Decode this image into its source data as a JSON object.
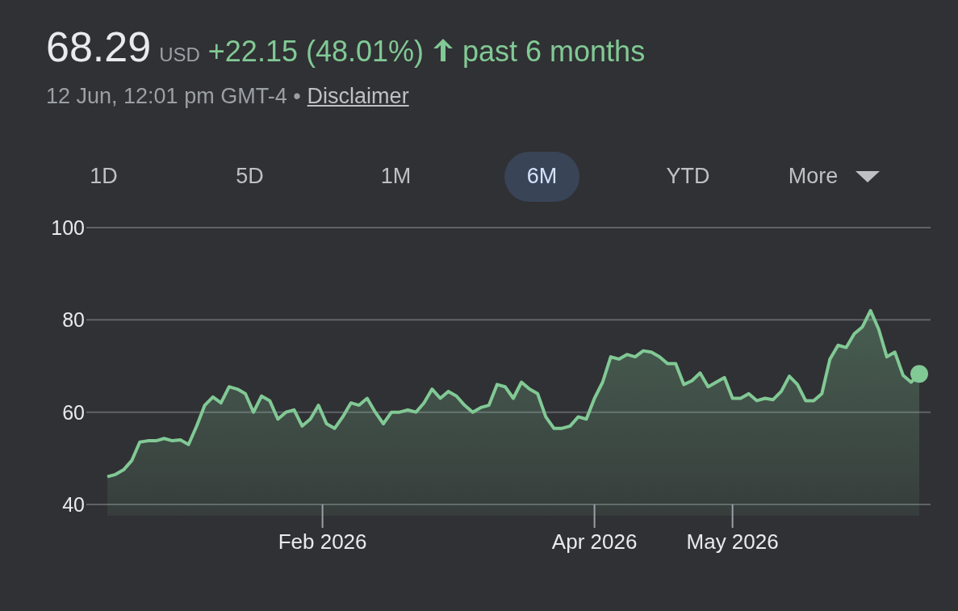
{
  "quote": {
    "price": "68.29",
    "currency": "USD",
    "change": "+22.15 (48.01%)",
    "period": "past 6 months",
    "timestamp": "12 Jun, 12:01 pm GMT-4 •",
    "disclaimer": "Disclaimer"
  },
  "ranges": [
    {
      "label": "1D",
      "selected": false
    },
    {
      "label": "5D",
      "selected": false
    },
    {
      "label": "1M",
      "selected": false
    },
    {
      "label": "6M",
      "selected": true
    },
    {
      "label": "YTD",
      "selected": false
    },
    {
      "label": "More",
      "selected": false,
      "kind": "dropdown"
    }
  ],
  "chart": {
    "x_axis_labels": [
      "Feb 2026",
      "Apr 2026",
      "May 2026"
    ],
    "chart_data": {
      "type": "area",
      "ylim": [
        40,
        100
      ],
      "yticks": [
        40,
        60,
        80,
        100
      ],
      "series": [
        {
          "color": "#81c995",
          "values": [
            46,
            46.5,
            47.5,
            49.5,
            53.5,
            53.8,
            53.8,
            54.3,
            53.8,
            54,
            53,
            57,
            61.5,
            63.3,
            62,
            65.5,
            65,
            64,
            60,
            63.5,
            62.5,
            58.5,
            60,
            60.5,
            57,
            58.5,
            61.5,
            57.5,
            56.5,
            59,
            62,
            61.5,
            63,
            60,
            57.5,
            60,
            60,
            60.5,
            60,
            62,
            65,
            63,
            64.5,
            63.5,
            61.5,
            60,
            61,
            61.5,
            66,
            65.5,
            63,
            66.5,
            65,
            64,
            59,
            56.5,
            56.5,
            57,
            59,
            58.5,
            63,
            66.5,
            72,
            71.5,
            72.5,
            72,
            73.3,
            73,
            72,
            70.5,
            70.5,
            66,
            66.8,
            68.5,
            65.5,
            66.5,
            67.5,
            63,
            63,
            64,
            62.5,
            63,
            62.7,
            64.5,
            67.8,
            66,
            62.5,
            62.5,
            64,
            71.5,
            74.5,
            74,
            77,
            78.5,
            82,
            78,
            72,
            73,
            68,
            66.5,
            68.3
          ]
        }
      ]
    }
  }
}
